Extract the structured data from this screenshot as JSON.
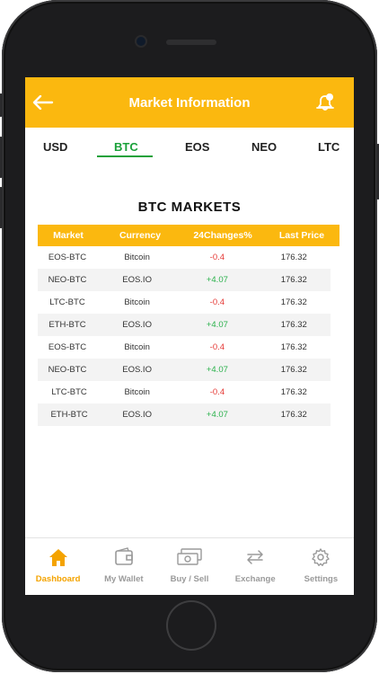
{
  "header": {
    "title": "Market Information"
  },
  "tabs": [
    {
      "label": "USD"
    },
    {
      "label": "BTC"
    },
    {
      "label": "EOS"
    },
    {
      "label": "NEO"
    },
    {
      "label": "LTC"
    }
  ],
  "active_tab": "BTC",
  "section": {
    "title": "BTC MARKETS"
  },
  "table": {
    "headers": [
      "Market",
      "Currency",
      "24Changes%",
      "Last Price"
    ],
    "rows": [
      {
        "market": "EOS-BTC",
        "currency": "Bitcoin",
        "change": "-0.4",
        "price": "176.32"
      },
      {
        "market": "NEO-BTC",
        "currency": "EOS.IO",
        "change": "+4.07",
        "price": "176.32"
      },
      {
        "market": "LTC-BTC",
        "currency": "Bitcoin",
        "change": "-0.4",
        "price": "176.32"
      },
      {
        "market": "ETH-BTC",
        "currency": "EOS.IO",
        "change": "+4.07",
        "price": "176.32"
      },
      {
        "market": "EOS-BTC",
        "currency": "Bitcoin",
        "change": "-0.4",
        "price": "176.32"
      },
      {
        "market": "NEO-BTC",
        "currency": "EOS.IO",
        "change": "+4.07",
        "price": "176.32"
      },
      {
        "market": "LTC-BTC",
        "currency": "Bitcoin",
        "change": "-0.4",
        "price": "176.32"
      },
      {
        "market": "ETH-BTC",
        "currency": "EOS.IO",
        "change": "+4.07",
        "price": "176.32"
      }
    ]
  },
  "nav": [
    {
      "label": "Dashboard",
      "icon": "home-icon"
    },
    {
      "label": "My Wallet",
      "icon": "wallet-icon"
    },
    {
      "label": "Buy / Sell",
      "icon": "money-icon"
    },
    {
      "label": "Exchange",
      "icon": "exchange-icon"
    },
    {
      "label": "Settings",
      "icon": "gear-icon"
    }
  ],
  "colors": {
    "accent": "#fbb80f",
    "active_tab": "#1aa13a",
    "positive": "#2bb24c",
    "negative": "#e53935",
    "nav_active": "#f4a300"
  }
}
